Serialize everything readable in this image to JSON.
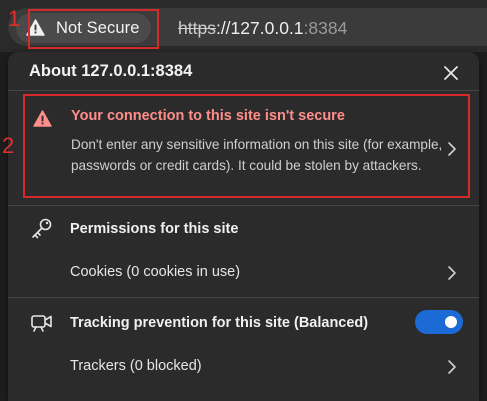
{
  "address_bar": {
    "site_info_label": "Not Secure",
    "url_scheme": "https",
    "url_separator": "://",
    "url_host": "127.0.0.1",
    "url_port": ":8384"
  },
  "annotations": {
    "marker_1": "1",
    "marker_2": "2",
    "color": "#d42a2a"
  },
  "panel": {
    "title": "About 127.0.0.1:8384",
    "connection": {
      "title": "Your connection to this site isn't secure",
      "description": "Don't enter any sensitive information on this site (for example, passwords or credit cards). It could be stolen by attackers.",
      "icon": "warning-triangle-icon"
    },
    "permissions": {
      "title": "Permissions for this site",
      "icon": "key-icon",
      "cookies_label": "Cookies (0 cookies in use)"
    },
    "tracking": {
      "title": "Tracking prevention for this site (Balanced)",
      "icon": "camera-icon",
      "enabled": true,
      "trackers_label": "Trackers (0 blocked)"
    }
  },
  "colors": {
    "warning_red": "#ff8e8a",
    "toggle_blue": "#1c6ad6",
    "panel_bg": "#2b2b2b"
  }
}
